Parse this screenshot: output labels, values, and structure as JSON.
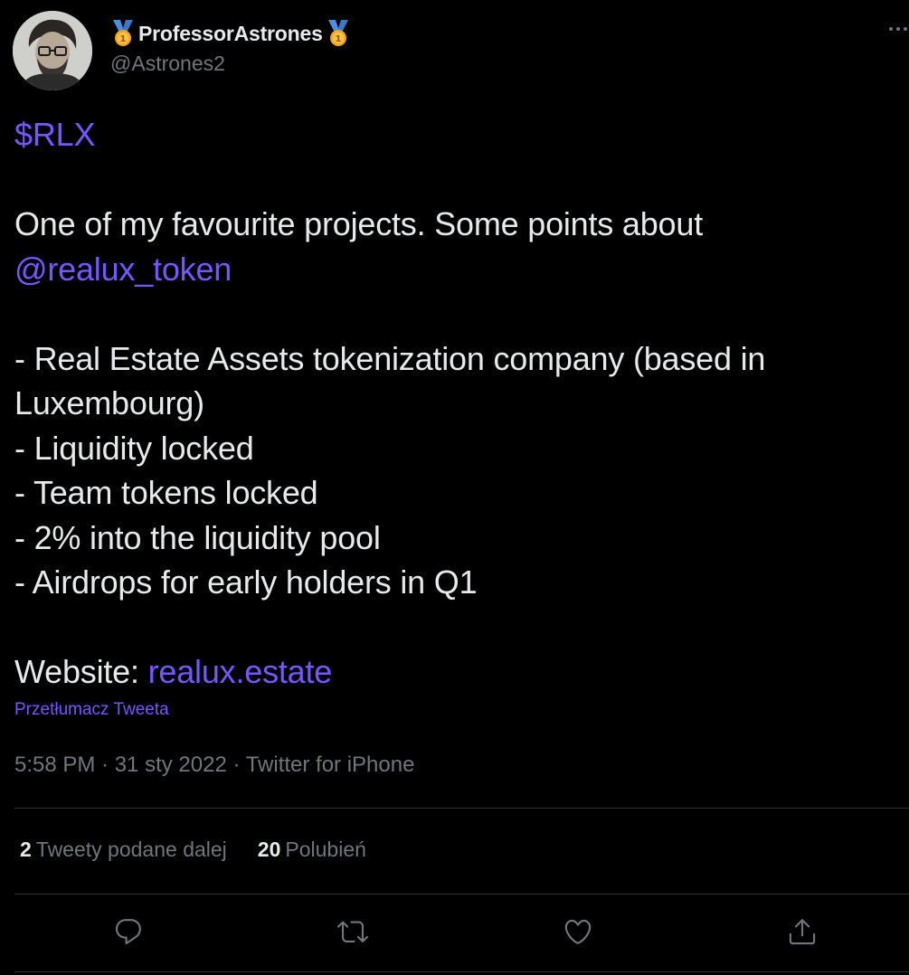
{
  "user": {
    "display_name": "ProfessorAstrones",
    "handle": "@Astrones2"
  },
  "tweet": {
    "cashtag": "$RLX",
    "intro": "One of my favourite projects. Some points about",
    "mention": "@realux_token",
    "points": [
      "- Real Estate Assets tokenization company (based in",
      "Luxembourg)",
      "- Liquidity locked",
      "- Team tokens locked",
      "- 2% into the liquidity pool",
      "- Airdrops for early holders in Q1"
    ],
    "website_label": "Website: ",
    "website_link": "realux.estate",
    "translate_label": "Przetłumacz Tweeta",
    "meta": "5:58 PM · 31 sty 2022 · Twitter for iPhone"
  },
  "stats": {
    "retweets_count": "2",
    "retweets_label": "Tweety podane dalej",
    "likes_count": "20",
    "likes_label": "Polubień"
  },
  "icons": {
    "reply": "reply-icon",
    "retweet": "retweet-icon",
    "like": "heart-icon",
    "share": "share-icon",
    "more": "more-icon",
    "medal": "medal-icon"
  },
  "colors": {
    "background": "#000000",
    "text": "#e7e9ea",
    "secondary": "#71767b",
    "accent": "#7856ff",
    "divider": "#2f3336"
  }
}
